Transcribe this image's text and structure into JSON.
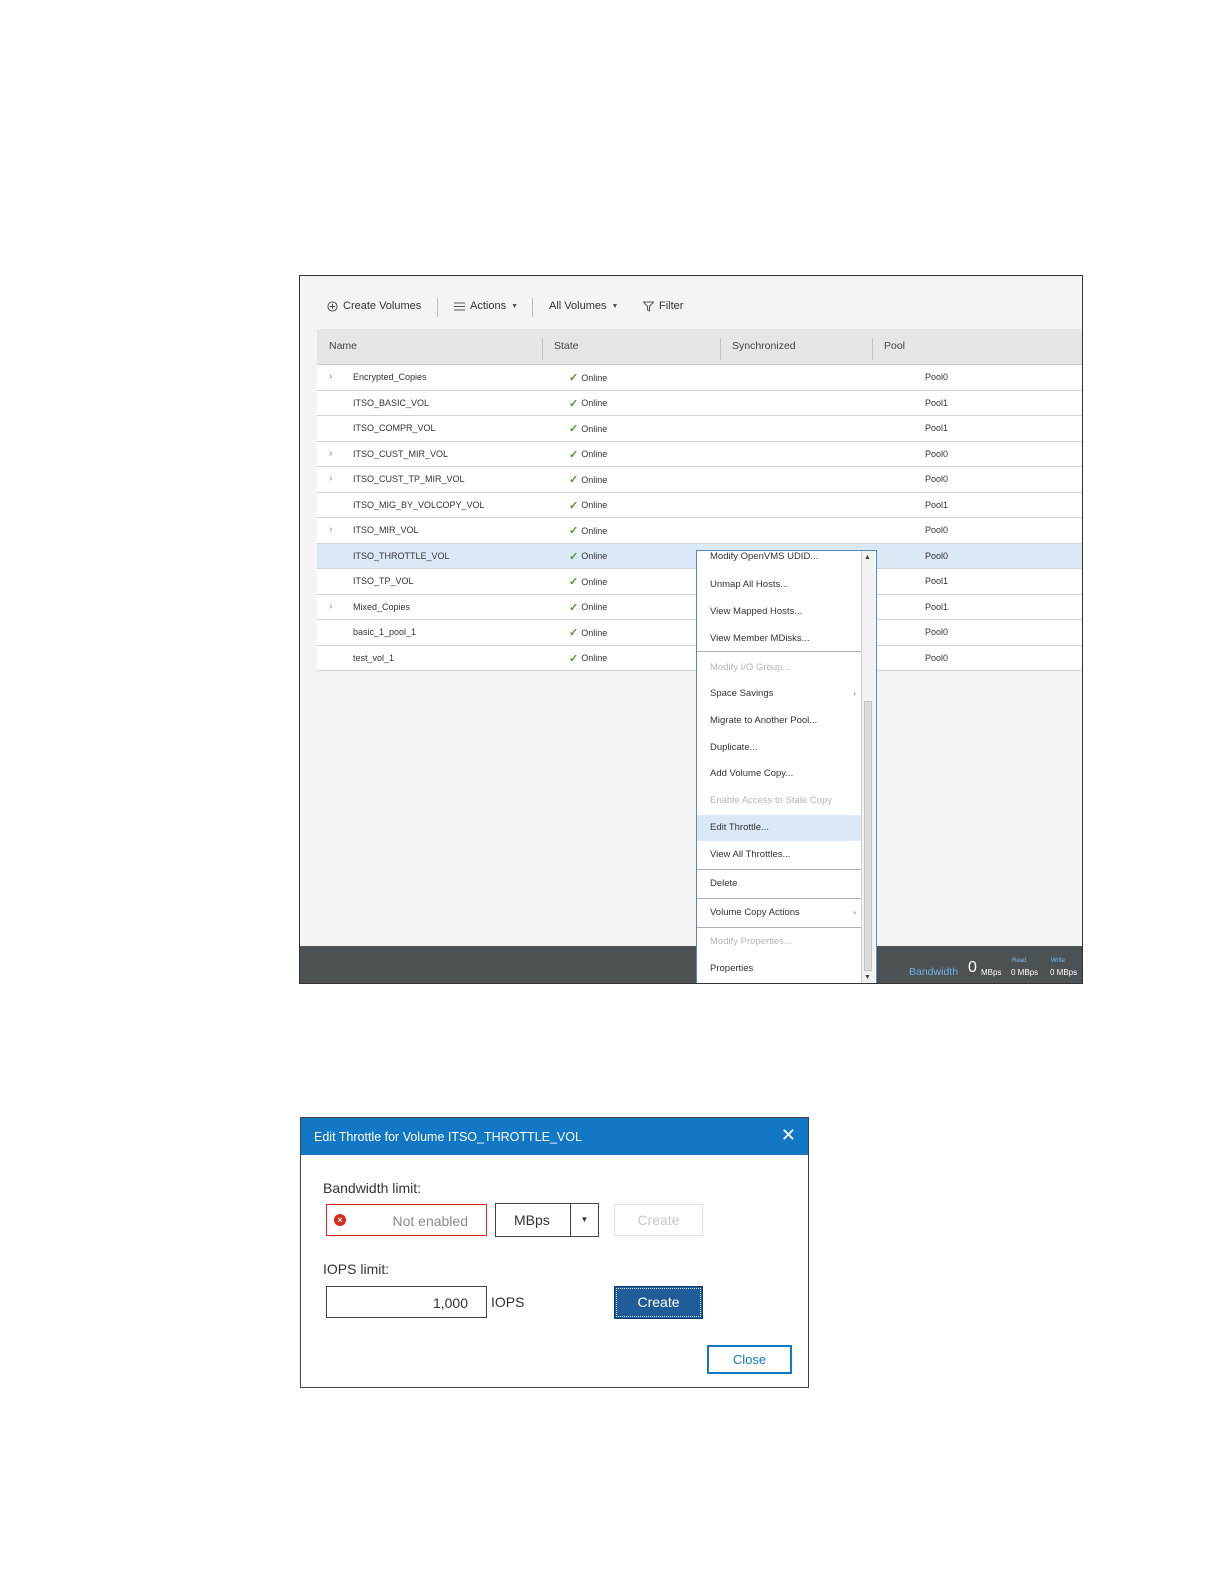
{
  "toolbar": {
    "create_volumes": "Create Volumes",
    "actions": "Actions",
    "all_volumes": "All Volumes",
    "filter": "Filter"
  },
  "columns": {
    "name": "Name",
    "state": "State",
    "synchronized": "Synchronized",
    "pool": "Pool"
  },
  "rows": [
    {
      "name": "Encrypted_Copies",
      "state": "Online",
      "pool": "Pool0",
      "expandable": true
    },
    {
      "name": "ITSO_BASIC_VOL",
      "state": "Online",
      "pool": "Pool1",
      "expandable": false
    },
    {
      "name": "ITSO_COMPR_VOL",
      "state": "Online",
      "pool": "Pool1",
      "expandable": false
    },
    {
      "name": "ITSO_CUST_MIR_VOL",
      "state": "Online",
      "pool": "Pool0",
      "expandable": true
    },
    {
      "name": "ITSO_CUST_TP_MIR_VOL",
      "state": "Online",
      "pool": "Pool0",
      "expandable": true
    },
    {
      "name": "ITSO_MIG_BY_VOLCOPY_VOL",
      "state": "Online",
      "pool": "Pool1",
      "expandable": false
    },
    {
      "name": "ITSO_MIR_VOL",
      "state": "Online",
      "pool": "Pool0",
      "expandable": true
    },
    {
      "name": "ITSO_THROTTLE_VOL",
      "state": "Online",
      "pool": "Pool0",
      "expandable": false,
      "selected": true
    },
    {
      "name": "ITSO_TP_VOL",
      "state": "Online",
      "pool": "Pool1",
      "expandable": false
    },
    {
      "name": "Mixed_Copies",
      "state": "Online",
      "pool": "Pool1",
      "expandable": true
    },
    {
      "name": "basic_1_pool_1",
      "state": "Online",
      "pool": "Pool0",
      "expandable": false
    },
    {
      "name": "test_vol_1",
      "state": "Online",
      "pool": "Pool0",
      "expandable": false
    }
  ],
  "context_menu": [
    {
      "label": "Modify OpenVMS UDID...",
      "disabled": false
    },
    {
      "label": "Unmap All Hosts...",
      "disabled": false
    },
    {
      "label": "View Mapped Hosts...",
      "disabled": false
    },
    {
      "label": "View Member MDisks...",
      "disabled": false
    },
    {
      "label": "Modify I/O Group...",
      "disabled": true
    },
    {
      "label": "Space Savings",
      "disabled": false,
      "submenu": true
    },
    {
      "label": "Migrate to Another Pool...",
      "disabled": false
    },
    {
      "label": "Duplicate...",
      "disabled": false
    },
    {
      "label": "Add Volume Copy...",
      "disabled": false
    },
    {
      "label": "Enable Access to Stale Copy",
      "disabled": true
    },
    {
      "label": "Edit Throttle...",
      "disabled": false,
      "highlighted": true
    },
    {
      "label": "View All Throttles...",
      "disabled": false
    },
    {
      "label": "Delete",
      "disabled": false
    },
    {
      "label": "Volume Copy Actions",
      "disabled": false,
      "submenu": true
    },
    {
      "label": "Modify Properties...",
      "disabled": true
    },
    {
      "label": "Properties",
      "disabled": false
    }
  ],
  "statusbar": {
    "bandwidth_label": "Bandwidth",
    "bandwidth_value": "0",
    "bandwidth_unit": "MBps",
    "read_label": "Read",
    "read_value": "0 MBps",
    "write_label": "Write",
    "write_value": "0 MBps"
  },
  "dialog": {
    "title": "Edit Throttle for Volume ITSO_THROTTLE_VOL",
    "bandwidth_label": "Bandwidth limit:",
    "bandwidth_placeholder": "Not enabled",
    "bandwidth_unit": "MBps",
    "bandwidth_create": "Create",
    "iops_label": "IOPS limit:",
    "iops_value": "1,000",
    "iops_unit": "IOPS",
    "iops_create": "Create",
    "close": "Close"
  },
  "colors": {
    "dialog_header": "#1277c4",
    "primary_button": "#1f5c98",
    "error": "#d9281c",
    "online_check": "#4c9a2a",
    "selected_row": "#dbe9f6"
  }
}
